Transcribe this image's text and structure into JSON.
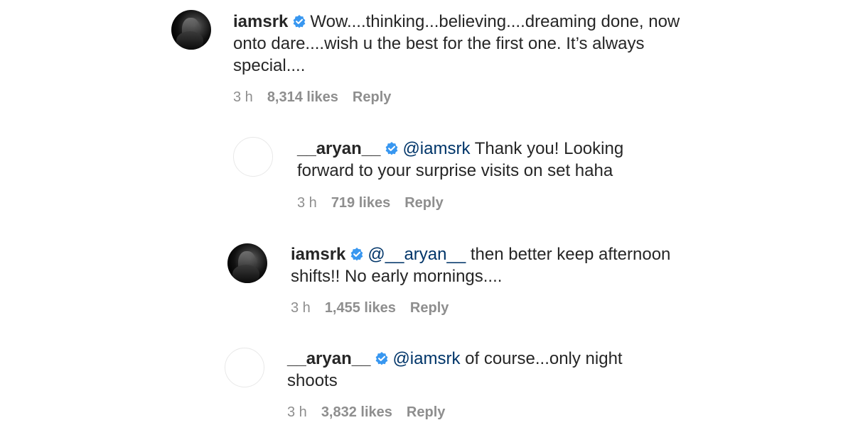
{
  "colors": {
    "verified": "#3897f0",
    "text": "#262626",
    "mention": "#003569",
    "meta": "#8e8e8e"
  },
  "icons": {
    "avatar_iamsrk": "profile-photo-dark",
    "avatar_aryan": "blank-profile-circle",
    "verified": "verified-badge-icon"
  },
  "comments": [
    {
      "username": "iamsrk",
      "mention": "",
      "line1": "Wow....thinking...believing....dreaming done, now",
      "line2": "onto dare....wish u the best for the first one. It’s always",
      "line3": "special....",
      "time": "3 h",
      "likes": "8,314 likes",
      "reply": "Reply"
    },
    {
      "username": "__aryan__",
      "mention": "@iamsrk",
      "line1": "Thank you! Looking",
      "line2": "forward to your surprise visits on set haha",
      "time": "3 h",
      "likes": "719 likes",
      "reply": "Reply"
    },
    {
      "username": "iamsrk",
      "mention": "@__aryan__",
      "line1": "then better keep afternoon",
      "line2": "shifts!! No early mornings....",
      "time": "3 h",
      "likes": "1,455 likes",
      "reply": "Reply"
    },
    {
      "username": "__aryan__",
      "mention": "@iamsrk",
      "line1": "of course...only night",
      "line2": "shoots",
      "time": "3 h",
      "likes": "3,832 likes",
      "reply": "Reply"
    }
  ]
}
